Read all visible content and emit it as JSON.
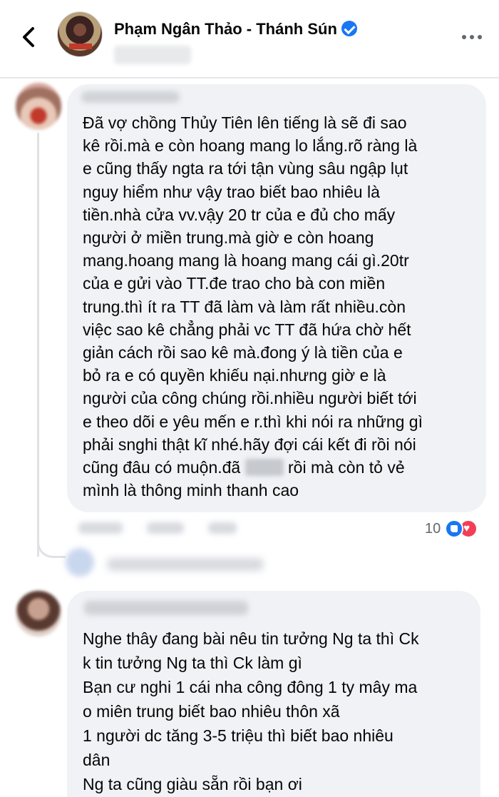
{
  "header": {
    "page_name": "Phạm Ngân Thảo - Thánh Sún",
    "verified": true
  },
  "comments": [
    {
      "lines": [
        "Đã vợ chồng Thủy Tiên lên tiếng là sẽ đi sao",
        "kê rồi.mà e còn hoang mang lo lắng.rõ ràng là",
        "e cũng thấy ngta ra tới tận vùng sâu ngập lụt",
        "nguy hiểm như vậy trao biết bao nhiêu là",
        "tiền.nhà cửa vv.vậy 20 tr của e đủ cho mấy",
        "người ở miền trung.mà giờ e còn hoang",
        "mang.hoang mang là hoang mang cái gì.20tr",
        "của e gửi vào TT.đe trao cho bà con miền",
        "trung.thì ít ra TT đã làm và làm rất nhiều.còn",
        "việc sao kê chẳng phải vc TT đã hứa chờ hết",
        "giản cách rồi sao kê mà.đong ý là tiền của e",
        "bỏ ra e có quyền khiếu nại.nhưng giờ e là",
        "người của công chúng rồi.nhiều người biết tới",
        "e theo dõi e yêu mến e r.thì khi nói ra những gì",
        "phải snghi thật kĩ nhé.hãy đợi cái kết đi rồi nói"
      ],
      "line_censor_before": "cũng đâu có muộn.đã",
      "line_censor_after": "rồi mà còn tỏ vẻ",
      "last_line": "mình là thông minh thanh cao",
      "reaction_count": "10"
    },
    {
      "lines": [
        "Nghe thây đang bài nêu tin tưởng Ng ta thì Ck",
        "k tin tưởng Ng ta thì Ck làm gì",
        "Bạn cư nghi 1 cái nha công đông 1 ty mây ma",
        "o miên trung biết bao nhiêu thôn xã",
        "1 người dc tăng 3-5 triệu thì biết bao nhiêu",
        "dân",
        "Ng ta cũng giàu sẵn rồi bạn ơi"
      ]
    }
  ],
  "icons": {
    "back": "chevron-left-icon",
    "more": "more-horizontal-icon",
    "verified": "verified-badge-icon",
    "like": "like-reaction-icon",
    "love": "love-reaction-icon"
  },
  "colors": {
    "bubble": "#f0f2f5",
    "verified": "#1877f2",
    "like": "#1877f2",
    "love": "#f33e58",
    "meta_text": "#65676b"
  }
}
